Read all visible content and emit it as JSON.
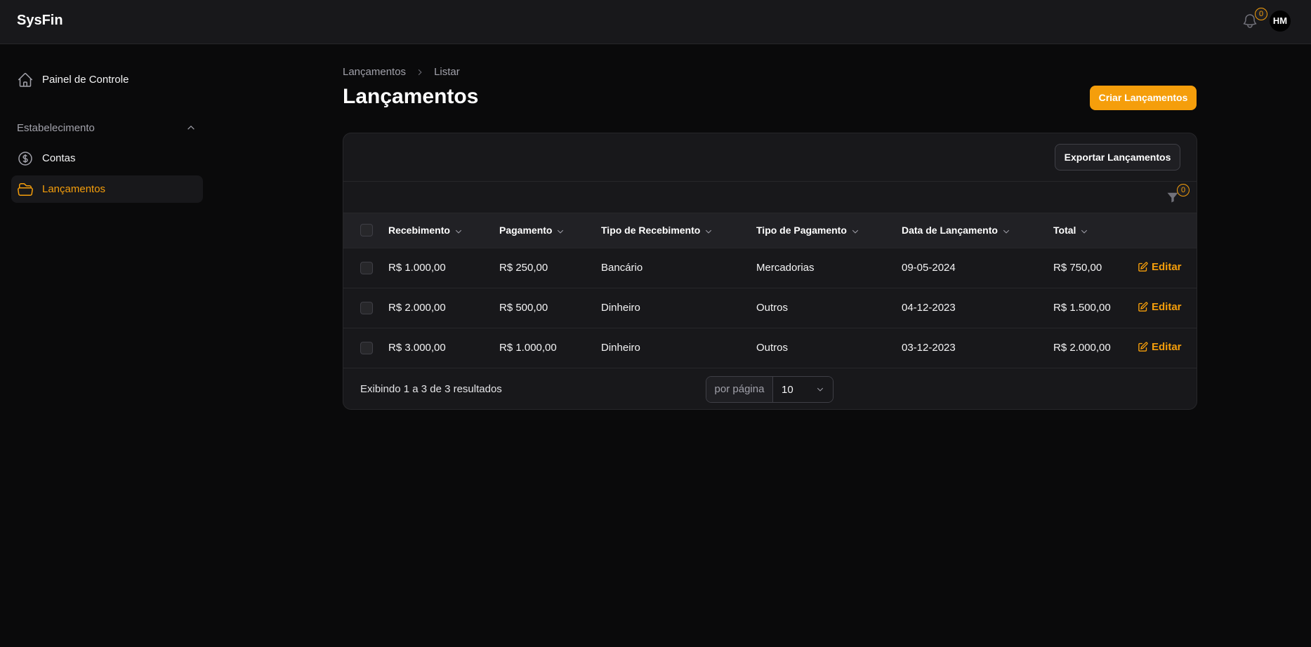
{
  "app": {
    "brand": "SysFin",
    "notifications_count": "0",
    "user_initials": "HM"
  },
  "sidebar": {
    "dashboard_label": "Painel de Controle",
    "group_label": "Estabelecimento",
    "items": [
      {
        "label": "Contas",
        "icon": "dollar-circle-icon"
      },
      {
        "label": "Lançamentos",
        "icon": "folder-icon",
        "active": true
      }
    ]
  },
  "breadcrumb": {
    "parent": "Lançamentos",
    "current": "Listar"
  },
  "page": {
    "title": "Lançamentos",
    "create_label": "Criar Lançamentos"
  },
  "table": {
    "export_label": "Exportar Lançamentos",
    "filter_count": "0",
    "columns": [
      "Recebimento",
      "Pagamento",
      "Tipo de Recebimento",
      "Tipo de Pagamento",
      "Data de Lançamento",
      "Total"
    ],
    "rows": [
      {
        "recebimento": "R$ 1.000,00",
        "pagamento": "R$ 250,00",
        "tipo_recebimento": "Bancário",
        "tipo_pagamento": "Mercadorias",
        "data": "09-05-2024",
        "total": "R$ 750,00"
      },
      {
        "recebimento": "R$ 2.000,00",
        "pagamento": "R$ 500,00",
        "tipo_recebimento": "Dinheiro",
        "tipo_pagamento": "Outros",
        "data": "04-12-2023",
        "total": "R$ 1.500,00"
      },
      {
        "recebimento": "R$ 3.000,00",
        "pagamento": "R$ 1.000,00",
        "tipo_recebimento": "Dinheiro",
        "tipo_pagamento": "Outros",
        "data": "03-12-2023",
        "total": "R$ 2.000,00"
      }
    ],
    "edit_label": "Editar",
    "results_text": "Exibindo 1 a 3 de 3 resultados",
    "per_page_label": "por página",
    "per_page_value": "10"
  },
  "colors": {
    "accent": "#f59e0b",
    "background": "#0a0a0b",
    "surface": "#18181b"
  }
}
